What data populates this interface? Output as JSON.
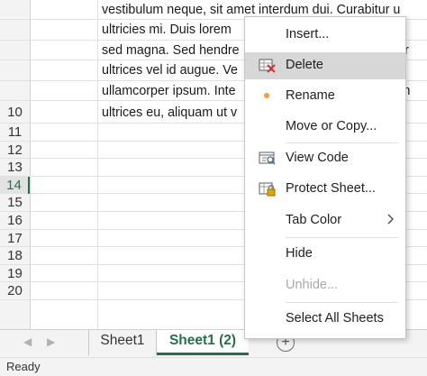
{
  "grid": {
    "rows": [
      {
        "num": "",
        "text": "vestibulum neque, sit amet interdum dui. Curabitur u"
      },
      {
        "num": "",
        "text": "ultricies mi. Duis lorem                                         , vo"
      },
      {
        "num": "",
        "text": "sed magna. Sed hendre                                          retr"
      },
      {
        "num": "",
        "text": "ultrices vel id augue. Ve                                         u,"
      },
      {
        "num": "",
        "text": "ullamcorper ipsum. Inte                                          cum"
      },
      {
        "num": "10",
        "text": "ultrices eu, aliquam ut v"
      },
      {
        "num": "11",
        "text": ""
      },
      {
        "num": "12",
        "text": ""
      },
      {
        "num": "13",
        "text": ""
      },
      {
        "num": "14",
        "text": ""
      },
      {
        "num": "15",
        "text": ""
      },
      {
        "num": "16",
        "text": ""
      },
      {
        "num": "17",
        "text": ""
      },
      {
        "num": "18",
        "text": ""
      },
      {
        "num": "19",
        "text": ""
      },
      {
        "num": "20",
        "text": ""
      }
    ],
    "selected_row": "14"
  },
  "context_menu": {
    "items": [
      {
        "label": "Insert...",
        "icon": ""
      },
      {
        "label": "Delete",
        "icon": "delete-sheet-icon",
        "highlighted": true
      },
      {
        "label": "Rename",
        "icon": "bullet-icon"
      },
      {
        "label": "Move or Copy...",
        "icon": ""
      },
      {
        "label": "View Code",
        "icon": "view-code-icon"
      },
      {
        "label": "Protect Sheet...",
        "icon": "protect-sheet-icon"
      },
      {
        "label": "Tab Color",
        "icon": "",
        "submenu": true
      },
      {
        "label": "Hide",
        "icon": ""
      },
      {
        "label": "Unhide...",
        "icon": "",
        "disabled": true
      },
      {
        "label": "Select All Sheets",
        "icon": ""
      }
    ]
  },
  "sheet_tabs": {
    "tabs": [
      {
        "label": "Sheet1",
        "active": false
      },
      {
        "label": "Sheet1 (2)",
        "active": true
      }
    ],
    "add_sheet_icon": "plus-circle-icon",
    "nav_icons": [
      "scroll-left-icon",
      "scroll-right-icon"
    ]
  },
  "status_bar": {
    "text": "Ready"
  },
  "colors": {
    "accent": "#217346",
    "highlight": "#d7d7d7",
    "bullet": "#f0a130"
  }
}
